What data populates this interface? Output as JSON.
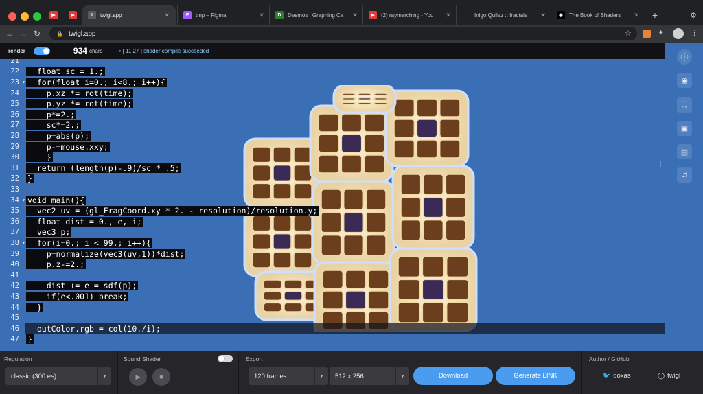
{
  "browser": {
    "tabs": [
      {
        "label": "",
        "favicon": "youtube-icon",
        "color": "#e53935"
      },
      {
        "label": "",
        "favicon": "youtube-icon",
        "color": "#e53935"
      },
      {
        "label": "twigl.app",
        "favicon": "twigl-icon",
        "color": "#202124",
        "active": true
      },
      {
        "label": "tmp – Figma",
        "favicon": "figma-icon",
        "color": "#a259ff"
      },
      {
        "label": "Desmos | Graphing Ca",
        "favicon": "desmos-icon",
        "color": "#2e7d32"
      },
      {
        "label": "(2) raymarching - You",
        "favicon": "youtube-icon",
        "color": "#e53935"
      },
      {
        "label": "Inigo Quilez :: fractals",
        "favicon": "iq-icon",
        "color": "#202124"
      },
      {
        "label": "The Book of Shaders",
        "favicon": "bookofshaders-icon",
        "color": "#111"
      }
    ],
    "new_tab": "+",
    "url": "twigl.app"
  },
  "app": {
    "render_label": "render",
    "char_count": "934",
    "char_unit": "chars",
    "status": "• [ 11:27 ] shader compile succeeded"
  },
  "code": [
    {
      "n": "21",
      "text": ""
    },
    {
      "n": "22",
      "text": "  float sc = 1.;"
    },
    {
      "n": "23",
      "text": "  for(float i=0.; i<8.; i++){",
      "fold": true
    },
    {
      "n": "24",
      "text": "    p.xz *= rot(time);"
    },
    {
      "n": "25",
      "text": "    p.yz *= rot(time);"
    },
    {
      "n": "26",
      "text": "    p*=2.;"
    },
    {
      "n": "27",
      "text": "    sc*=2.;"
    },
    {
      "n": "28",
      "text": "    p=abs(p);"
    },
    {
      "n": "29",
      "text": "    p-=mouse.xxy;"
    },
    {
      "n": "30",
      "text": "    }"
    },
    {
      "n": "31",
      "text": "  return (length(p)-.9)/sc * .5;"
    },
    {
      "n": "32",
      "text": "}"
    },
    {
      "n": "33",
      "text": ""
    },
    {
      "n": "34",
      "text": "void main(){",
      "fold": true
    },
    {
      "n": "35",
      "text": "  vec2 uv = (gl_FragCoord.xy * 2. - resolution)/resolution.y;"
    },
    {
      "n": "36",
      "text": "  float dist = 0., e, i;"
    },
    {
      "n": "37",
      "text": "  vec3 p;"
    },
    {
      "n": "38",
      "text": "  for(i=0.; i < 99.; i++){",
      "fold": true
    },
    {
      "n": "39",
      "text": "    p=normalize(vec3(uv,1))*dist;"
    },
    {
      "n": "40",
      "text": "    p.z-=2.;"
    },
    {
      "n": "41",
      "text": ""
    },
    {
      "n": "42",
      "text": "    dist += e = sdf(p);"
    },
    {
      "n": "43",
      "text": "    if(e<.001) break;"
    },
    {
      "n": "44",
      "text": "  }"
    },
    {
      "n": "45",
      "text": ""
    },
    {
      "n": "46",
      "text": "  outColor.rgb = col(10./i);",
      "current": true
    },
    {
      "n": "47",
      "text": "}"
    }
  ],
  "right_icons": [
    "info-icon",
    "broadcast-icon",
    "fullscreen-icon",
    "editor-view-icon",
    "layout-icon",
    "music-icon"
  ],
  "panel": {
    "regulation": {
      "title": "Regulation",
      "value": "classic (300 es)"
    },
    "sound": {
      "title": "Sound Shader"
    },
    "export": {
      "title": "Export",
      "frames": "120 frames",
      "size": "512 x 256",
      "download": "Download",
      "generate": "Generate LINK"
    },
    "author": {
      "title": "Author / GitHub",
      "twitter": "doxas",
      "github": "twigl"
    }
  },
  "colors": {
    "canvas_bg": "#3a6fb5",
    "accent": "#4a9cf0"
  }
}
